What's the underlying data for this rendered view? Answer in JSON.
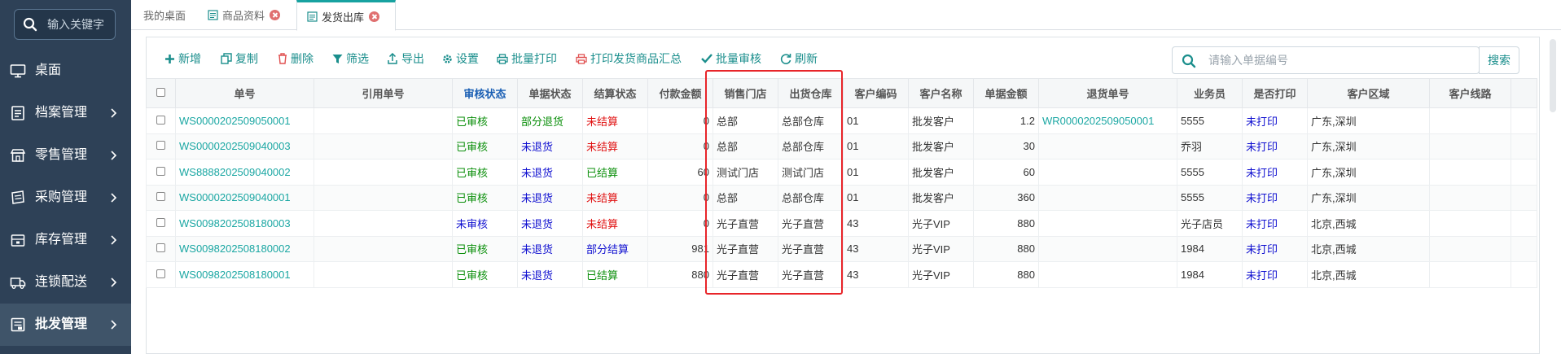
{
  "sidebar": {
    "search_placeholder": "输入关键字",
    "items": [
      {
        "label": "桌面",
        "icon": "desktop-icon",
        "has_arrow": false
      },
      {
        "label": "档案管理",
        "icon": "archive-icon",
        "has_arrow": true
      },
      {
        "label": "零售管理",
        "icon": "store-icon",
        "has_arrow": true
      },
      {
        "label": "采购管理",
        "icon": "purchase-icon",
        "has_arrow": true
      },
      {
        "label": "库存管理",
        "icon": "inventory-icon",
        "has_arrow": true
      },
      {
        "label": "连锁配送",
        "icon": "truck-icon",
        "has_arrow": true
      },
      {
        "label": "批发管理",
        "icon": "wholesale-icon",
        "has_arrow": true,
        "active": true
      }
    ]
  },
  "tabs": [
    {
      "label": "我的桌面"
    },
    {
      "label": "商品资料"
    },
    {
      "label": "发货出库"
    }
  ],
  "toolbar": {
    "buttons": [
      "新增",
      "复制",
      "删除",
      "筛选",
      "导出",
      "设置",
      "批量打印",
      "打印发货商品汇总",
      "批量审核",
      "刷新"
    ],
    "search_placeholder": "请输入单据编号",
    "search_button": "搜索"
  },
  "table": {
    "columns": [
      "单号",
      "引用单号",
      "审核状态",
      "单据状态",
      "结算状态",
      "付款金额",
      "销售门店",
      "出货仓库",
      "客户编码",
      "客户名称",
      "单据金额",
      "退货单号",
      "业务员",
      "是否打印",
      "客户区域",
      "客户线路"
    ],
    "rows": [
      [
        "WS0000202509050001",
        "",
        "已审核",
        "部分退货",
        "未结算",
        "0",
        "总部",
        "总部仓库",
        "01",
        "批发客户",
        "1.2",
        "WR0000202509050001",
        "5555",
        "未打印",
        "广东,深圳",
        ""
      ],
      [
        "WS0000202509040003",
        "",
        "已审核",
        "未退货",
        "未结算",
        "0",
        "总部",
        "总部仓库",
        "01",
        "批发客户",
        "30",
        "",
        "乔羽",
        "未打印",
        "广东,深圳",
        ""
      ],
      [
        "WS8888202509040002",
        "",
        "已审核",
        "未退货",
        "已结算",
        "60",
        "测试门店",
        "测试门店",
        "01",
        "批发客户",
        "60",
        "",
        "5555",
        "未打印",
        "广东,深圳",
        ""
      ],
      [
        "WS0000202509040001",
        "",
        "已审核",
        "未退货",
        "未结算",
        "0",
        "总部",
        "总部仓库",
        "01",
        "批发客户",
        "360",
        "",
        "5555",
        "未打印",
        "广东,深圳",
        ""
      ],
      [
        "WS0098202508180003",
        "",
        "未审核",
        "未退货",
        "未结算",
        "0",
        "光子直营",
        "光子直营",
        "43",
        "光子VIP",
        "880",
        "",
        "光子店员",
        "未打印",
        "北京,西城",
        ""
      ],
      [
        "WS0098202508180002",
        "",
        "已审核",
        "未退货",
        "部分结算",
        "981",
        "光子直营",
        "光子直营",
        "43",
        "光子VIP",
        "880",
        "",
        "1984",
        "未打印",
        "北京,西城",
        ""
      ],
      [
        "WS0098202508180001",
        "",
        "已审核",
        "未退货",
        "已结算",
        "880",
        "光子直营",
        "光子直营",
        "43",
        "光子VIP",
        "880",
        "",
        "1984",
        "未打印",
        "北京,西城",
        ""
      ]
    ]
  },
  "colors": {
    "sidebar_bg": "#2e4157",
    "accent": "#1a8e8c",
    "highlight_border": "#e8252a"
  }
}
